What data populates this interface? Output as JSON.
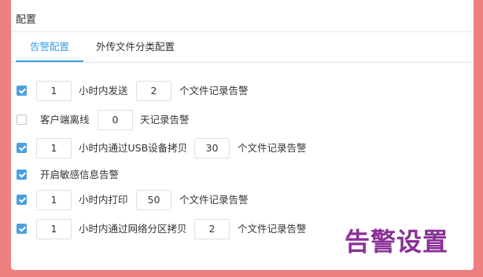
{
  "panel": {
    "title": "配置"
  },
  "tabs": [
    {
      "label": "告警配置",
      "active": true
    },
    {
      "label": "外传文件分类配置",
      "active": false
    }
  ],
  "rules": [
    {
      "checked": true,
      "value1": "1",
      "text1": "小时内发送",
      "value2": "2",
      "text2": "个文件记录告警"
    },
    {
      "checked": false,
      "text0": "客户端离线",
      "value1": "0",
      "text1": "天记录告警"
    },
    {
      "checked": true,
      "value1": "1",
      "text1": "小时内通过USB设备拷贝",
      "value2": "30",
      "text2": "个文件记录告警"
    },
    {
      "checked": true,
      "text0": "开启敏感信息告警"
    },
    {
      "checked": true,
      "value1": "1",
      "text1": "小时内打印",
      "value2": "50",
      "text2": "个文件记录告警"
    },
    {
      "checked": true,
      "value1": "1",
      "text1": "小时内通过网络分区拷贝",
      "value2": "2",
      "text2": "个文件记录告警"
    }
  ],
  "watermark": "告警设置",
  "colors": {
    "accent": "#39a0e6",
    "background": "#ee7f7f",
    "watermark": "#8a2f97"
  }
}
